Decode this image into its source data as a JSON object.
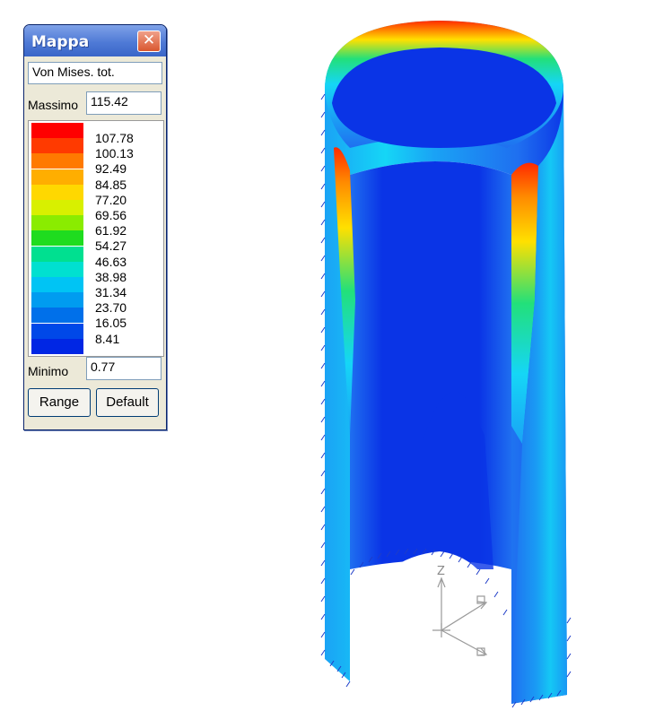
{
  "window": {
    "title": "Mappa",
    "close_glyph": "✕",
    "quantity": "Von Mises. tot.",
    "max_label": "Massimo",
    "max_value": "115.42",
    "min_label": "Minimo",
    "min_value": "0.77",
    "range_button": "Range",
    "default_button": "Default"
  },
  "legend": {
    "colors": [
      "#ff0000",
      "#ff3a00",
      "#ff7a00",
      "#ffae00",
      "#ffd800",
      "#d8f000",
      "#8aec00",
      "#1fdc1f",
      "#00e090",
      "#00e0d0",
      "#00c4f4",
      "#009cf0",
      "#0070ea",
      "#0048e8",
      "#0026e4"
    ],
    "ticks": [
      "107.78",
      "100.13",
      "92.49",
      "84.85",
      "77.20",
      "69.56",
      "61.92",
      "54.27",
      "46.63",
      "38.98",
      "31.34",
      "23.70",
      "16.05",
      "8.41"
    ]
  },
  "plot": {
    "axis_label": "Z",
    "colors": {
      "deep": "#0a34e6",
      "mid": "#1f6ff0",
      "light": "#1aa3f5",
      "cyan": "#15d6f6",
      "green": "#22e07a",
      "yellow": "#ffe000",
      "orange": "#ff8a00",
      "red": "#ff2a00"
    }
  }
}
